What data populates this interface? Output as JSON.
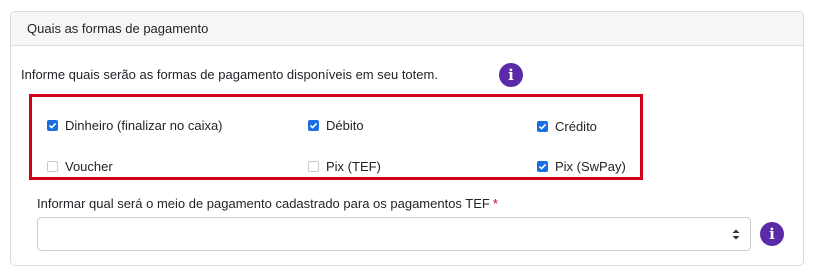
{
  "card": {
    "title": "Quais as formas de pagamento",
    "intro": "Informe quais serão as formas de pagamento disponíveis em seu totem."
  },
  "payment_options": [
    {
      "label": "Dinheiro (finalizar no caixa)",
      "checked": true
    },
    {
      "label": "Débito",
      "checked": true
    },
    {
      "label": "Crédito",
      "checked": true
    },
    {
      "label": "Voucher",
      "checked": false
    },
    {
      "label": "Pix (TEF)",
      "checked": false
    },
    {
      "label": "Pix (SwPay)",
      "checked": true
    }
  ],
  "tef": {
    "label": "Informar qual será o meio de pagamento cadastrado para os pagamentos TEF",
    "required_mark": "*",
    "selected_value": ""
  },
  "icons": {
    "info": "info-icon",
    "info_glyph": "i"
  },
  "colors": {
    "accent_purple": "#5a2aa8",
    "checkbox_blue": "#1a6ee0",
    "highlight_red": "#d0021b"
  }
}
